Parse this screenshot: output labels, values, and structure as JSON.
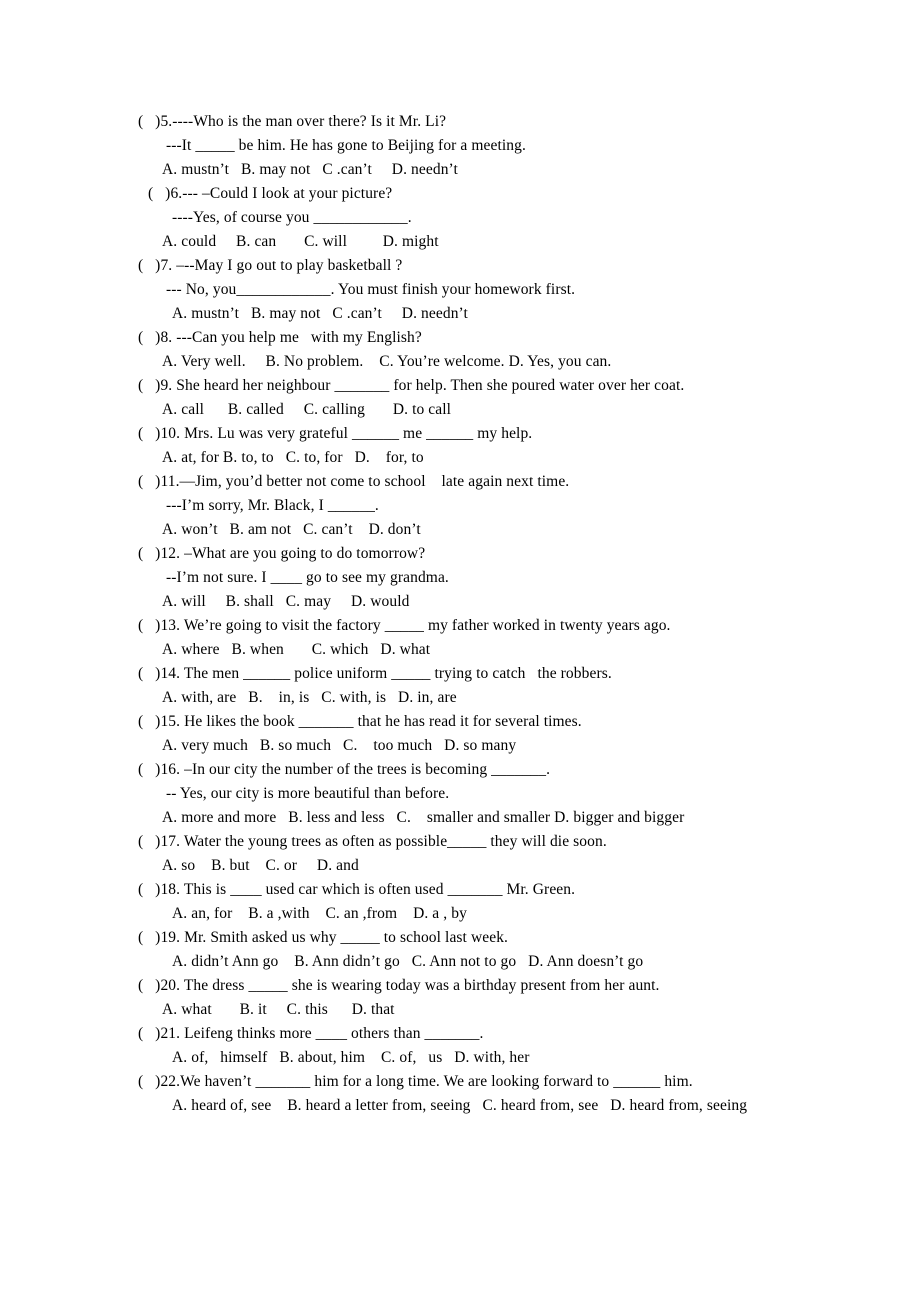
{
  "document": {
    "type": "multiple-choice-grammar-worksheet",
    "questions": [
      {
        "number": "5",
        "lines": [
          {
            "text": "(   )5.----Who is the man over there? Is it Mr. Li?",
            "indent": "stem-a"
          },
          {
            "text": "---It _____ be him. He has gone to Beijing for a meeting.",
            "indent": "reply"
          },
          {
            "text": "A. mustn’t   B. may not   C .can’t     D. needn’t",
            "indent": "opts"
          }
        ]
      },
      {
        "number": "6",
        "lines": [
          {
            "text": "(   )6.--- –Could I look at your picture?",
            "indent": "stem-b"
          },
          {
            "text": "----Yes, of course you ____________.",
            "indent": "reply2"
          },
          {
            "text": "A. could     B. can       C. will         D. might",
            "indent": "opts"
          }
        ]
      },
      {
        "number": "7",
        "lines": [
          {
            "text": "(   )7. –--May I go out to play basketball ?",
            "indent": "stem-a"
          },
          {
            "text": "--- No, you____________. You must finish your homework first.",
            "indent": "reply"
          },
          {
            "text": "A. mustn’t   B. may not   C .can’t     D. needn’t",
            "indent": "opts2"
          }
        ]
      },
      {
        "number": "8",
        "lines": [
          {
            "text": "(   )8. ---Can you help me   with my English?",
            "indent": "stem-a"
          },
          {
            "text": "A. Very well.     B. No problem.    C. You’re welcome. D. Yes, you can.",
            "indent": "opts"
          }
        ]
      },
      {
        "number": "9",
        "lines": [
          {
            "text": "(   )9. She heard her neighbour _______ for help. Then she poured water over her coat.",
            "indent": "stem-a"
          },
          {
            "text": "A. call      B. called     C. calling       D. to call",
            "indent": "opts"
          }
        ]
      },
      {
        "number": "10",
        "lines": [
          {
            "text": "(   )10. Mrs. Lu was very grateful ______ me ______ my help.",
            "indent": "stem-a"
          },
          {
            "text": "A. at, for B. to, to   C. to, for   D.    for, to",
            "indent": "opts"
          }
        ]
      },
      {
        "number": "11",
        "lines": [
          {
            "text": "(   )11.—Jim, you’d better not come to school    late again next time.",
            "indent": "stem-a"
          },
          {
            "text": "---I’m sorry, Mr. Black, I ______.",
            "indent": "reply"
          },
          {
            "text": "A. won’t   B. am not   C. can’t    D. don’t",
            "indent": "opts"
          }
        ]
      },
      {
        "number": "12",
        "lines": [
          {
            "text": "(   )12. –What are you going to do tomorrow?",
            "indent": "stem-a"
          },
          {
            "text": "--I’m not sure. I ____ go to see my grandma.",
            "indent": "reply"
          },
          {
            "text": "A. will     B. shall   C. may     D. would",
            "indent": "opts"
          }
        ]
      },
      {
        "number": "13",
        "lines": [
          {
            "text": "(   )13. We’re going to visit the factory _____ my father worked in twenty years ago.",
            "indent": "stem-a"
          },
          {
            "text": "A. where   B. when       C. which   D. what",
            "indent": "opts"
          }
        ]
      },
      {
        "number": "14",
        "lines": [
          {
            "text": "(   )14. The men ______ police uniform _____ trying to catch   the robbers.",
            "indent": "stem-a"
          },
          {
            "text": "A. with, are   B.    in, is   C. with, is   D. in, are",
            "indent": "opts"
          }
        ]
      },
      {
        "number": "15",
        "lines": [
          {
            "text": "(   )15. He likes the book _______ that he has read it for several times.",
            "indent": "stem-a"
          },
          {
            "text": "A. very much   B. so much   C.    too much   D. so many",
            "indent": "opts"
          }
        ]
      },
      {
        "number": "16",
        "lines": [
          {
            "text": "(   )16. –In our city the number of the trees is becoming _______.",
            "indent": "stem-a"
          },
          {
            "text": "-- Yes, our city is more beautiful than before.",
            "indent": "reply"
          },
          {
            "text": "A. more and more   B. less and less   C.    smaller and smaller D. bigger and bigger",
            "indent": "opts"
          }
        ]
      },
      {
        "number": "17",
        "lines": [
          {
            "text": "(   )17. Water the young trees as often as possible_____ they will die soon.",
            "indent": "stem-a"
          },
          {
            "text": "A. so    B. but    C. or     D. and",
            "indent": "opts"
          }
        ]
      },
      {
        "number": "18",
        "lines": [
          {
            "text": "(   )18. This is ____ used car which is often used _______ Mr. Green.",
            "indent": "stem-a"
          },
          {
            "text": "A. an, for    B. a ,with    C. an ,from    D. a , by",
            "indent": "opts2"
          }
        ]
      },
      {
        "number": "19",
        "lines": [
          {
            "text": "(   )19. Mr. Smith asked us why _____ to school last week.",
            "indent": "stem-a"
          },
          {
            "text": "A. didn’t Ann go    B. Ann didn’t go   C. Ann not to go   D. Ann doesn’t go",
            "indent": "opts2"
          }
        ]
      },
      {
        "number": "20",
        "lines": [
          {
            "text": "(   )20. The dress _____ she is wearing today was a birthday present from her aunt.",
            "indent": "stem-a"
          },
          {
            "text": "A. what       B. it     C. this      D. that",
            "indent": "opts"
          }
        ]
      },
      {
        "number": "21",
        "lines": [
          {
            "text": "(   )21. Leifeng thinks more ____ others than _______.",
            "indent": "stem-a"
          },
          {
            "text": "A. of,   himself   B. about, him    C. of,   us   D. with, her",
            "indent": "opts2"
          }
        ]
      },
      {
        "number": "22",
        "lines": [
          {
            "text": "(   )22.We haven’t _______ him for a long time. We are looking forward to ______ him.",
            "indent": "stem-a"
          },
          {
            "text": "A. heard of, see    B. heard a letter from, seeing   C. heard from, see   D. heard from, seeing",
            "indent": "opts2"
          }
        ]
      }
    ]
  }
}
